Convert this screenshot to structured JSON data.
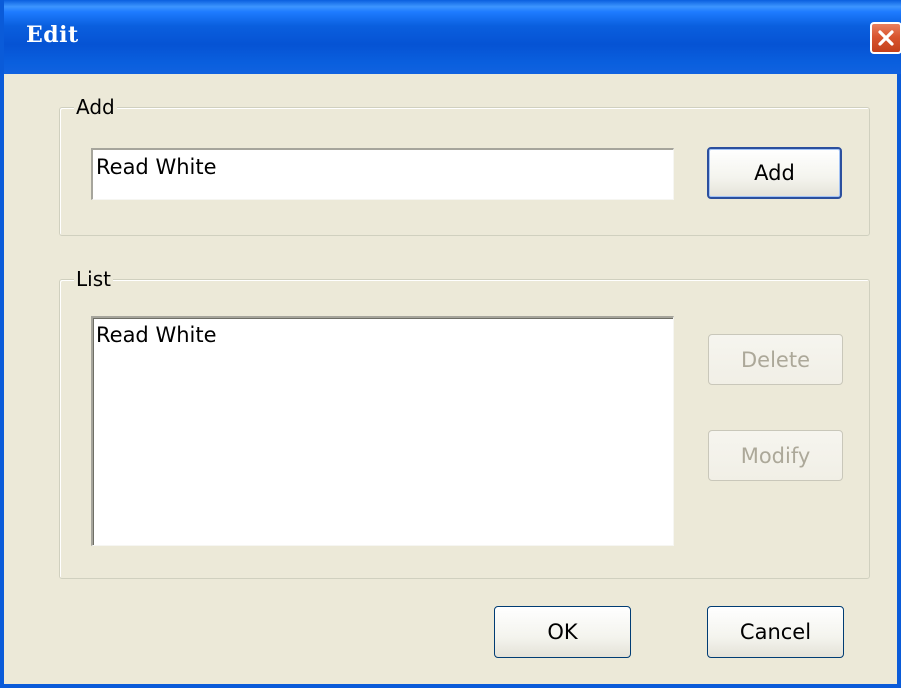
{
  "window": {
    "title": "Edit",
    "close_icon": "close-icon",
    "accent_color": "#0a5fde",
    "close_color": "#d9552f"
  },
  "add_group": {
    "legend": "Add",
    "input_value": "Read White",
    "button_label": "Add"
  },
  "list_group": {
    "legend": "List",
    "items": [
      "Read White"
    ],
    "delete_label": "Delete",
    "modify_label": "Modify"
  },
  "footer": {
    "ok_label": "OK",
    "cancel_label": "Cancel"
  }
}
